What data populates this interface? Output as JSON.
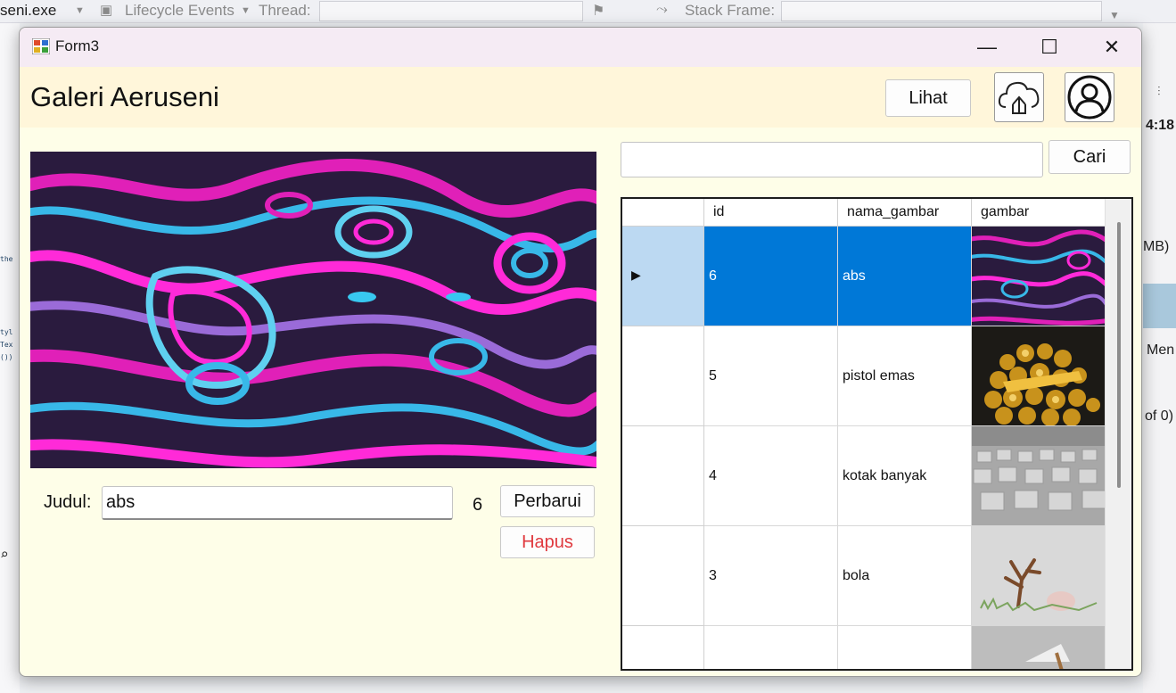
{
  "ide": {
    "process": "seni.exe",
    "lifecycle": "Lifecycle Events",
    "thread": "Thread:",
    "stack_frame": "Stack Frame:",
    "right_fragments": [
      "4:18",
      "MB)",
      "Men",
      "of 0)"
    ],
    "left_code": [
      "the",
      "tyl",
      "Tex",
      "())"
    ]
  },
  "window": {
    "title": "Form3",
    "minimize_glyph": "—",
    "maximize_glyph": "☐",
    "close_glyph": "✕"
  },
  "header": {
    "app_title": "Galeri Aeruseni",
    "view_button": "Lihat"
  },
  "detail": {
    "judul_label": "Judul:",
    "judul_value": "abs",
    "id_value": "6",
    "update_button": "Perbarui",
    "delete_button": "Hapus"
  },
  "search": {
    "value": "",
    "button": "Cari"
  },
  "grid": {
    "columns": [
      "id",
      "nama_gambar",
      "gambar"
    ],
    "rows": [
      {
        "id": "6",
        "nama_gambar": "abs",
        "thumb": "abstract-neon"
      },
      {
        "id": "5",
        "nama_gambar": "pistol emas",
        "thumb": "gold-coins"
      },
      {
        "id": "4",
        "nama_gambar": "kotak banyak",
        "thumb": "grey-boxes"
      },
      {
        "id": "3",
        "nama_gambar": "bola",
        "thumb": "tree-ball"
      },
      {
        "id": "",
        "nama_gambar": "",
        "thumb": "grey"
      }
    ],
    "selected_row": 0
  },
  "colors": {
    "form_bg": "#fefee8",
    "header_bg": "#fff6da",
    "titlebar_bg": "#f5ebf4",
    "selection": "#0078d7",
    "delete_text": "#e0393e"
  }
}
